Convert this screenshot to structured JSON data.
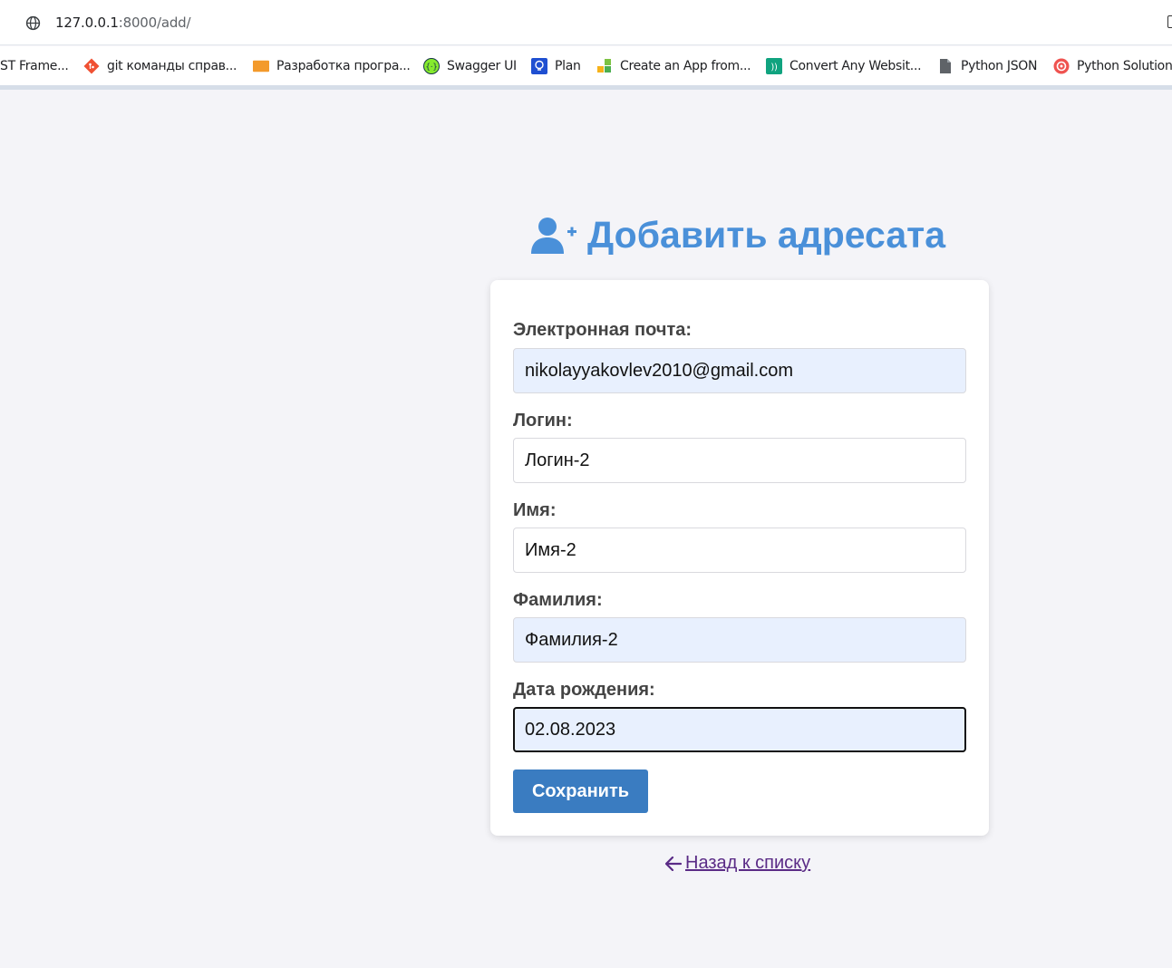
{
  "browser": {
    "url_host": "127.0.0.1",
    "url_rest": ":8000/add/",
    "bookmarks": [
      {
        "label": "ST Frame...",
        "icon": "none"
      },
      {
        "label": "git команды справ...",
        "icon": "git-icon"
      },
      {
        "label": "Разработка програ...",
        "icon": "orange-tile-icon"
      },
      {
        "label": "Swagger UI",
        "icon": "swagger-icon"
      },
      {
        "label": "Plan",
        "icon": "bulb-icon"
      },
      {
        "label": "Create an App from...",
        "icon": "colored-squares-icon"
      },
      {
        "label": "Convert Any Websit...",
        "icon": "green-app-icon"
      },
      {
        "label": "Python JSON",
        "icon": "document-icon"
      },
      {
        "label": "Python Solution",
        "icon": "openai-icon"
      }
    ]
  },
  "page": {
    "title": "Добавить адресата",
    "title_icon": "user-plus-icon",
    "accent_color": "#4a90d9",
    "form": {
      "email_label": "Электронная почта:",
      "email_value": "nikolayyakovlev2010@gmail.com",
      "login_label": "Логин:",
      "login_value": "Логин-2",
      "first_name_label": "Имя:",
      "first_name_value": "Имя-2",
      "last_name_label": "Фамилия:",
      "last_name_value": "Фамилия-2",
      "birth_date_label": "Дата рождения:",
      "birth_date_value": "02.08.2023",
      "save_label": "Сохранить"
    },
    "back_link": "Назад к списку",
    "back_icon": "arrow-left-icon"
  }
}
